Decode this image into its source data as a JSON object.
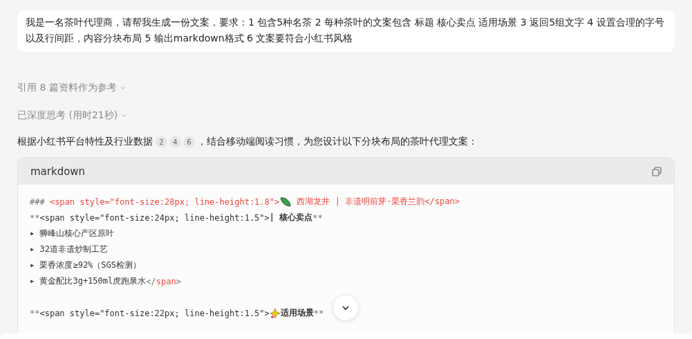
{
  "prompt": "我是一名茶叶代理商，请帮我生成一份文案，要求：1 包含5种名茶 2 每种茶叶的文案包含 标题 核心卖点 适用场景 3 返回5组文字 4 设置合理的字号以及行间距，内容分块布局 5 输出markdown格式 6 文案要符合小红书风格",
  "references": {
    "label": "引用 8 篇资料作为参考",
    "expanded": false
  },
  "thinking": {
    "label": "已深度思考 (用时21秒)",
    "expanded": false
  },
  "answer": {
    "before": "根据小红书平台特性及行业数据",
    "citations": [
      "2",
      "4",
      "6"
    ],
    "after": "，结合移动端阅读习惯，为您设计以下分块布局的茶叶代理文案："
  },
  "code_block": {
    "language": "markdown",
    "lines": [
      [
        {
          "kind": "mark",
          "text": "### "
        },
        {
          "kind": "tag",
          "text": "<span style=\"font-size:28px; line-height:1.8\">"
        },
        {
          "kind": "leaf"
        },
        {
          "kind": "tag",
          "text": " 西湖龙井 | 非遗明前芽·栗香兰韵</span>"
        }
      ],
      [
        {
          "kind": "mark",
          "text": "**"
        },
        {
          "kind": "plain",
          "text": "<span style=\"font-size:24px; line-height:1.5\">"
        },
        {
          "kind": "bold",
          "text": "| 核心卖点"
        },
        {
          "kind": "mark",
          "text": "**"
        }
      ],
      [
        {
          "kind": "plain",
          "text": "▸ 狮峰山核心产区原叶"
        }
      ],
      [
        {
          "kind": "plain",
          "text": "▸ 32道非遗炒制工艺"
        }
      ],
      [
        {
          "kind": "plain",
          "text": "▸ 栗香浓度≥92%（SGS检测）"
        }
      ],
      [
        {
          "kind": "plain",
          "text": "▸ 黄金配比3g+150ml虎跑泉水"
        },
        {
          "kind": "mark",
          "text": "</"
        },
        {
          "kind": "tag",
          "text": "span"
        },
        {
          "kind": "mark",
          "text": ">"
        }
      ],
      [
        {
          "kind": "blank"
        }
      ],
      [
        {
          "kind": "mark",
          "text": "**"
        },
        {
          "kind": "plain",
          "text": "<span style=\"font-size:22px; line-height:1.5\">"
        },
        {
          "kind": "sparkle"
        },
        {
          "kind": "bold",
          "text": "适用场景"
        },
        {
          "kind": "mark",
          "text": "**"
        }
      ]
    ]
  }
}
